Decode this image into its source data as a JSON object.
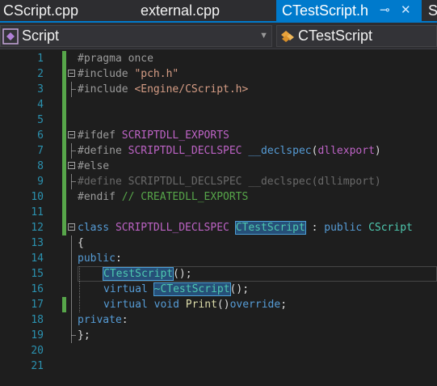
{
  "tabs": [
    {
      "label": "CScript.cpp"
    },
    {
      "label": "external.cpp"
    },
    {
      "label": "CTestScript.h",
      "pin": "⊸",
      "close": "✕"
    },
    {
      "label": "S"
    }
  ],
  "nav": {
    "scope": "Script",
    "member": "CTestScript"
  },
  "lines": [
    {
      "num": "1",
      "code": [
        "#pragma once"
      ]
    },
    {
      "num": "2",
      "code": [
        "#include ",
        "\"pch.h\""
      ]
    },
    {
      "num": "3",
      "code": [
        "#include ",
        "<Engine/CScript.h>"
      ]
    },
    {
      "num": "4",
      "code": []
    },
    {
      "num": "5",
      "code": []
    },
    {
      "num": "6",
      "code": [
        "#ifdef ",
        "SCRIPTDLL_EXPORTS"
      ]
    },
    {
      "num": "7",
      "code": [
        "#define ",
        "SCRIPTDLL_DECLSPEC",
        " ",
        "__declspec",
        "(",
        "dllexport",
        ")"
      ]
    },
    {
      "num": "8",
      "code": [
        "#else"
      ]
    },
    {
      "num": "9",
      "code": [
        "#define SCRIPTDLL_DECLSPEC __declspec(dllimport)"
      ]
    },
    {
      "num": "10",
      "code": [
        "#endif",
        " ",
        "// CREATEDLL_EXPORTS"
      ]
    },
    {
      "num": "11",
      "code": []
    },
    {
      "num": "12",
      "code": [
        "class",
        " ",
        "SCRIPTDLL_DECLSPEC",
        " ",
        "CTestScript",
        " : ",
        "public",
        " ",
        "CScript"
      ]
    },
    {
      "num": "13",
      "code": [
        "{"
      ]
    },
    {
      "num": "14",
      "code": [
        "public",
        ":"
      ]
    },
    {
      "num": "15",
      "code": [
        "CTestScript",
        "();"
      ]
    },
    {
      "num": "16",
      "code": [
        "virtual",
        " ",
        "~CTestScript",
        "();"
      ]
    },
    {
      "num": "17",
      "code": [
        "virtual",
        " ",
        "void",
        " ",
        "Print",
        "()",
        "override",
        ";"
      ]
    },
    {
      "num": "18",
      "code": [
        "private",
        ":"
      ]
    },
    {
      "num": "19",
      "code": [
        "};"
      ]
    },
    {
      "num": "20",
      "code": []
    },
    {
      "num": "21",
      "code": []
    }
  ]
}
